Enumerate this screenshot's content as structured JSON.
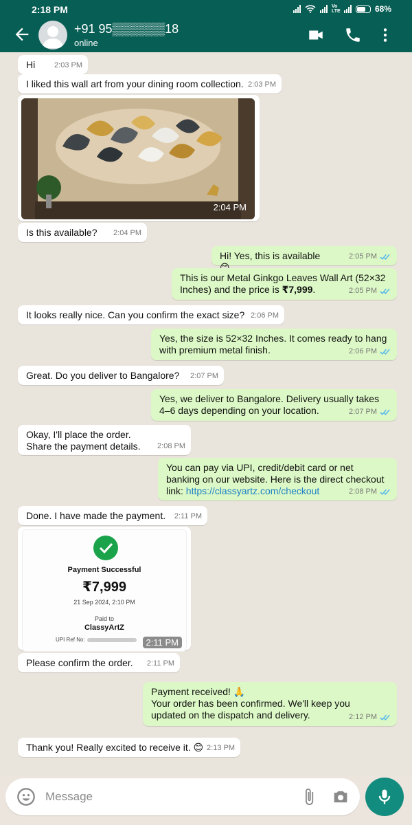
{
  "status_bar": {
    "time": "2:18 PM",
    "network": "Vo LTE",
    "battery": "68%"
  },
  "header": {
    "contact_name": "+91 95▒▒▒▒▒▒18",
    "status": "online"
  },
  "messages": [
    {
      "dir": "in",
      "text": "Hi",
      "time": "2:03 PM"
    },
    {
      "dir": "in",
      "text": "I liked this wall art from your dining room collection.",
      "time": "2:03 PM"
    },
    {
      "dir": "in",
      "type": "image",
      "time": "2:04 PM"
    },
    {
      "dir": "in",
      "text": "Is this available?",
      "time": "2:04 PM"
    },
    {
      "dir": "out",
      "text": "Hi! Yes, this is available 😊",
      "time": "2:05 PM"
    },
    {
      "dir": "out",
      "text_part1": "This is our Metal Ginkgo Leaves Wall Art (52×32 Inches) and the price is ",
      "text_bold": "₹7,999",
      "text_part2": ".",
      "time": "2:05 PM"
    },
    {
      "dir": "in",
      "text": "It looks really nice. Can you confirm the exact size?",
      "time": "2:06 PM"
    },
    {
      "dir": "out",
      "text": "Yes, the size is 52×32 Inches. It comes ready to hang with premium metal finish.",
      "time": "2:06 PM"
    },
    {
      "dir": "in",
      "text": "Great. Do you deliver to Bangalore?",
      "time": "2:07 PM"
    },
    {
      "dir": "out",
      "text": "Yes, we deliver to Bangalore. Delivery usually takes 4–6 days depending on your location.",
      "time": "2:07 PM"
    },
    {
      "dir": "in",
      "text_line1": "Okay, I'll place the order.",
      "text_line2": "Share the payment details.",
      "time": "2:08 PM"
    },
    {
      "dir": "out",
      "text": "You can pay via UPI, credit/debit card or net banking on our website. Here is the direct checkout link:",
      "link": "https://classyartz.com/checkout",
      "time": "2:08 PM"
    },
    {
      "dir": "in",
      "text": "Done. I have made the payment.",
      "time": "2:11 PM"
    },
    {
      "dir": "in",
      "type": "image",
      "time": "2:11 PM"
    },
    {
      "dir": "in",
      "text": "Please confirm the order.",
      "time": "2:11 PM"
    },
    {
      "dir": "out",
      "text_line1": "Payment received! 🙏",
      "text_line2": "Your order has been confirmed. We'll keep you updated on the dispatch and delivery.",
      "time": "2:12 PM"
    },
    {
      "dir": "in",
      "text": "Thank you! Really excited to receive it. 😊",
      "time": "2:13 PM"
    }
  ],
  "receipt": {
    "title": "Payment Successful",
    "amount": "₹7,999",
    "date": "21 Sep 2024, 2:10 PM",
    "paid_to_label": "Paid to",
    "merchant": "ClassyArtZ",
    "upi_ref_label": "UPI Ref No:"
  },
  "input": {
    "placeholder": "Message"
  },
  "colors": {
    "header": "#075e54",
    "outgoing_bubble": "#dcf8c6",
    "incoming_bubble": "#ffffff",
    "chat_background": "#e9e4dc",
    "mic_button": "#128c7e",
    "read_ticks": "#4fb6ec",
    "link": "#1b7fc6"
  },
  "icons": [
    "back-arrow-icon",
    "avatar-icon",
    "video-call-icon",
    "voice-call-icon",
    "more-options-icon",
    "emoji-icon",
    "attach-icon",
    "camera-icon",
    "mic-icon",
    "double-tick-icon",
    "check-icon"
  ]
}
